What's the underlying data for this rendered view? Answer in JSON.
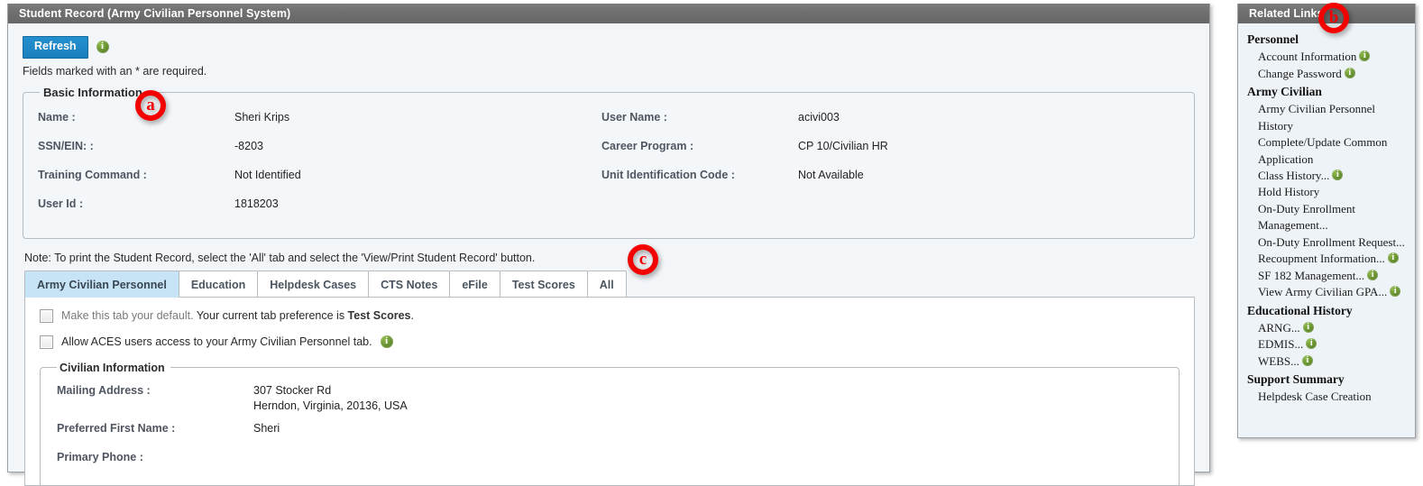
{
  "window": {
    "title": "Student Record (Army Civilian Personnel System)"
  },
  "toolbar": {
    "refresh_label": "Refresh",
    "refresh_info_icon": "info-icon",
    "required_note": "Fields marked with an * are required."
  },
  "basic_information": {
    "legend": "Basic Information",
    "left_fields": [
      {
        "label": "Name :",
        "value": "Sheri Krips"
      },
      {
        "label": "SSN/EIN: :",
        "value": "-8203"
      },
      {
        "label": "Training Command :",
        "value": "Not Identified"
      },
      {
        "label": "User Id :",
        "value": "1818203"
      }
    ],
    "right_fields": [
      {
        "label": "User Name :",
        "value": "acivi003"
      },
      {
        "label": "Career Program :",
        "value": "CP 10/Civilian HR"
      },
      {
        "label": "Unit Identification Code :",
        "value": "Not Available"
      }
    ]
  },
  "print_note": "Note: To print the Student Record, select the 'All' tab and select the 'View/Print Student Record' button.",
  "tabs": [
    {
      "label": "Army Civilian Personnel",
      "active": true
    },
    {
      "label": "Education",
      "active": false
    },
    {
      "label": "Helpdesk Cases",
      "active": false
    },
    {
      "label": "CTS Notes",
      "active": false
    },
    {
      "label": "eFile",
      "active": false
    },
    {
      "label": "Test Scores",
      "active": false
    },
    {
      "label": "All",
      "active": false
    }
  ],
  "tab_panel": {
    "default_tab_check": {
      "text_dim": "Make this tab your default.",
      "text_normal": " Your current tab preference is ",
      "text_bold": "Test Scores",
      "text_end": ".",
      "checked": false
    },
    "aces_check": {
      "text": "Allow ACES users access to your Army Civilian Personnel tab.",
      "info_icon": "info-icon",
      "checked": false
    },
    "civilian_information": {
      "legend": "Civilian Information",
      "fields": [
        {
          "label": "Mailing Address :",
          "value": "307 Stocker Rd\nHerndon, Virginia, 20136, USA"
        },
        {
          "label": "Preferred First Name :",
          "value": "Sheri"
        },
        {
          "label": "Primary Phone :",
          "value": ""
        }
      ]
    }
  },
  "related_links": {
    "title": "Related Links",
    "sections": [
      {
        "heading": "Personnel",
        "items": [
          {
            "label": "Account Information",
            "info": true
          },
          {
            "label": "Change Password",
            "info": true
          }
        ]
      },
      {
        "heading": "Army Civilian",
        "items": [
          {
            "label": "Army Civilian Personnel History",
            "info": false
          },
          {
            "label": "Complete/Update Common Application",
            "info": false
          },
          {
            "label": "Class History...",
            "info": true
          },
          {
            "label": "Hold History",
            "info": false
          },
          {
            "label": "On-Duty Enrollment Management...",
            "info": false
          },
          {
            "label": "On-Duty Enrollment Request...",
            "info": false
          },
          {
            "label": "Recoupment Information...",
            "info": true
          },
          {
            "label": "SF 182 Management...",
            "info": true
          },
          {
            "label": "View Army Civilian GPA...",
            "info": true
          }
        ]
      },
      {
        "heading": "Educational History",
        "items": [
          {
            "label": "ARNG...",
            "info": true
          },
          {
            "label": "EDMIS...",
            "info": true
          },
          {
            "label": "WEBS...",
            "info": true
          }
        ]
      },
      {
        "heading": "Support Summary",
        "items": [
          {
            "label": "Helpdesk Case Creation",
            "info": false
          }
        ]
      }
    ]
  },
  "annotations": [
    {
      "id": "a",
      "label": "a"
    },
    {
      "id": "b",
      "label": "b"
    },
    {
      "id": "c",
      "label": "c"
    }
  ],
  "colors": {
    "titlebar": "#6e6e6e",
    "refresh_button": "#1b7fbd",
    "active_tab": "#c7e4f7",
    "info_icon": "#6d9734",
    "annotation": "#f40000",
    "panel_background": "#f2f6f9"
  }
}
